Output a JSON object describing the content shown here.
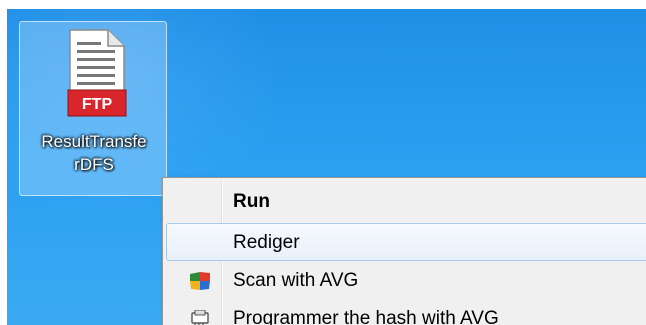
{
  "desktop": {
    "file": {
      "icon": "ftp-file-icon",
      "badge": "FTP",
      "name_line1": "ResultTransfe",
      "name_line2": "rDFS"
    }
  },
  "context_menu": {
    "items": [
      {
        "label": "Run",
        "bold": true,
        "icon": null
      },
      {
        "label": "Rediger",
        "highlighted": true,
        "icon": null
      },
      {
        "label": "Scan with AVG",
        "icon": "avg-icon"
      },
      {
        "label": "Programmer the hash with AVG",
        "icon": "avg-shredder-icon"
      }
    ]
  },
  "colors": {
    "desktop_blue": "#2a9ff0",
    "ftp_badge_red": "#d9262c",
    "menu_background": "#f0f0f0",
    "menu_hover_border": "#a8c8ec"
  }
}
